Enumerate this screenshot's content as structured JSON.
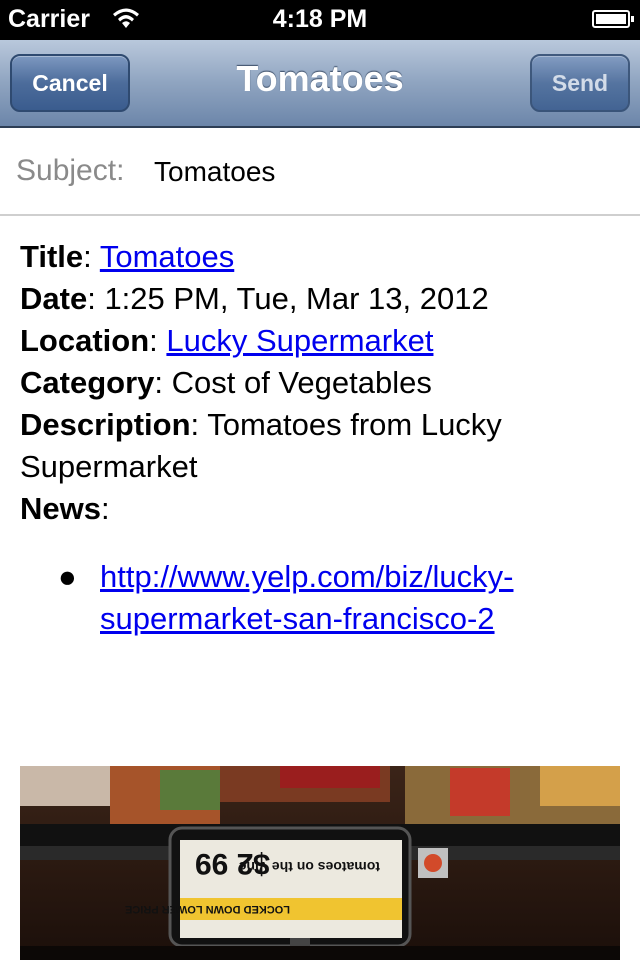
{
  "status_bar": {
    "carrier": "Carrier",
    "time": "4:18 PM"
  },
  "nav": {
    "title": "Tomatoes",
    "cancel_label": "Cancel",
    "send_label": "Send"
  },
  "subject": {
    "label": "Subject:",
    "value": "Tomatoes"
  },
  "details": {
    "title_key": "Title",
    "title_value": "Tomatoes",
    "date_key": "Date",
    "date_value": "1:25 PM, Tue, Mar 13, 2012",
    "location_key": "Location",
    "location_value": "Lucky Supermarket",
    "category_key": "Category",
    "category_value": "Cost of Vegetables",
    "description_key": "Description",
    "description_value": "Tomatoes from Lucky Supermarket",
    "news_key": "News",
    "news_items": [
      "http://www.yelp.com/biz/lucky-supermarket-san-francisco-2"
    ]
  },
  "photo": {
    "price_tag_price": "$2 99",
    "price_tag_text": "tomatoes on the Vine",
    "price_tag_banner": "LOCKED DOWN LOWER PRICE"
  },
  "colors": {
    "link": "#0000ee",
    "nav_bar": "#8fa4c0",
    "status_bar": "#000000"
  }
}
